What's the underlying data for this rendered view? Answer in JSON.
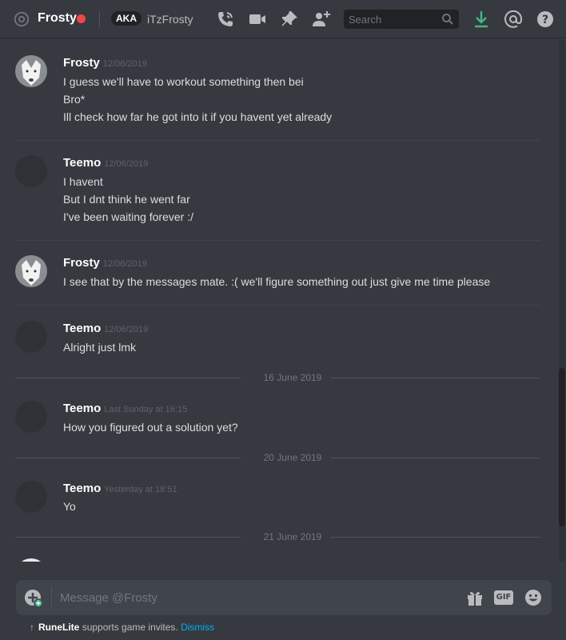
{
  "header": {
    "title": "Frosty",
    "aka_badge": "AKA",
    "aka_name": "iTzFrosty",
    "search_placeholder": "Search"
  },
  "colors": {
    "status": "#f04747",
    "download": "#43b581",
    "link": "#00b0f4"
  },
  "icons": [
    "at-icon",
    "voice-call-icon",
    "video-call-icon",
    "pin-icon",
    "add-friend-icon",
    "search-icon",
    "download-icon",
    "mentions-icon",
    "help-icon",
    "attach-icon",
    "gift-icon",
    "gif-icon",
    "emoji-icon"
  ],
  "messages": [
    {
      "author": "Frosty",
      "timestamp": "12/06/2019",
      "lines": [
        "I guess we'll have to workout something then bei",
        "Bro*",
        "Ill check how far he got into it if you havent yet already"
      ]
    },
    {
      "author": "Teemo",
      "timestamp": "12/06/2019",
      "lines": [
        "I havent",
        "But I dnt think he went far",
        "I've been waiting forever :/"
      ]
    },
    {
      "author": "Frosty",
      "timestamp": "12/06/2019",
      "lines": [
        "I see that by the messages mate. :( we'll figure something out just give me time please"
      ]
    },
    {
      "author": "Teemo",
      "timestamp": "12/06/2019",
      "lines": [
        "Alright just lmk"
      ]
    },
    {
      "author": "Teemo",
      "timestamp": "Last Sunday at 16:15",
      "lines": [
        "How you figured out a solution yet?"
      ]
    },
    {
      "author": "Teemo",
      "timestamp": "Yesterday at 18:51",
      "lines": [
        "Yo"
      ]
    }
  ],
  "date_dividers": [
    "16 June 2019",
    "20 June 2019",
    "21 June 2019"
  ],
  "composer": {
    "placeholder": "Message @Frosty",
    "gif_label": "GIF"
  },
  "footer": {
    "app": "RuneLite",
    "text": "supports game invites.",
    "dismiss": "Dismiss"
  }
}
